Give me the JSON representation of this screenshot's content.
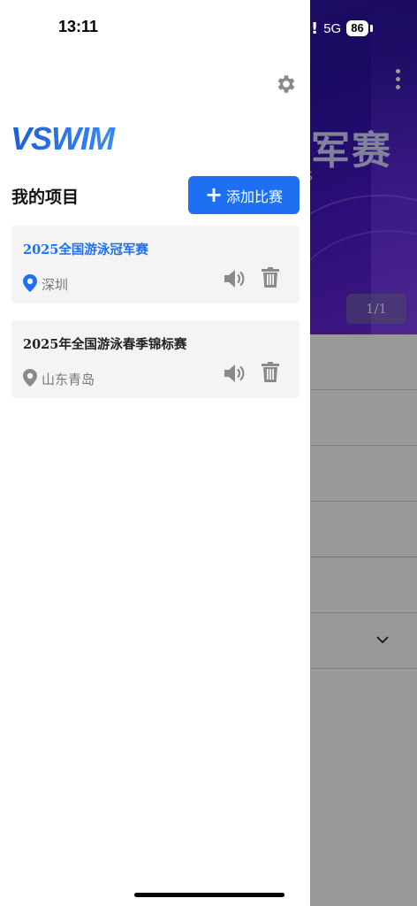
{
  "status_bar": {
    "time": "13:11",
    "network": "5G",
    "battery": "86",
    "alert": "!"
  },
  "background": {
    "title_fragment": "军赛",
    "subtitle_fragment": "S",
    "banner_counter": "1/1"
  },
  "drawer": {
    "logo_text": "VSWIM",
    "section_title": "我的项目",
    "add_button_label": "添加比赛",
    "projects": [
      {
        "title": "2025全国游泳冠军赛",
        "location": "深圳",
        "active": true
      },
      {
        "title": "2025年全国游泳春季锦标赛",
        "location": "山东青岛",
        "active": false
      }
    ]
  },
  "colors": {
    "accent": "#1e6ff2",
    "card_bg": "#f4f4f4",
    "icon_gray": "#8a8a8a"
  }
}
